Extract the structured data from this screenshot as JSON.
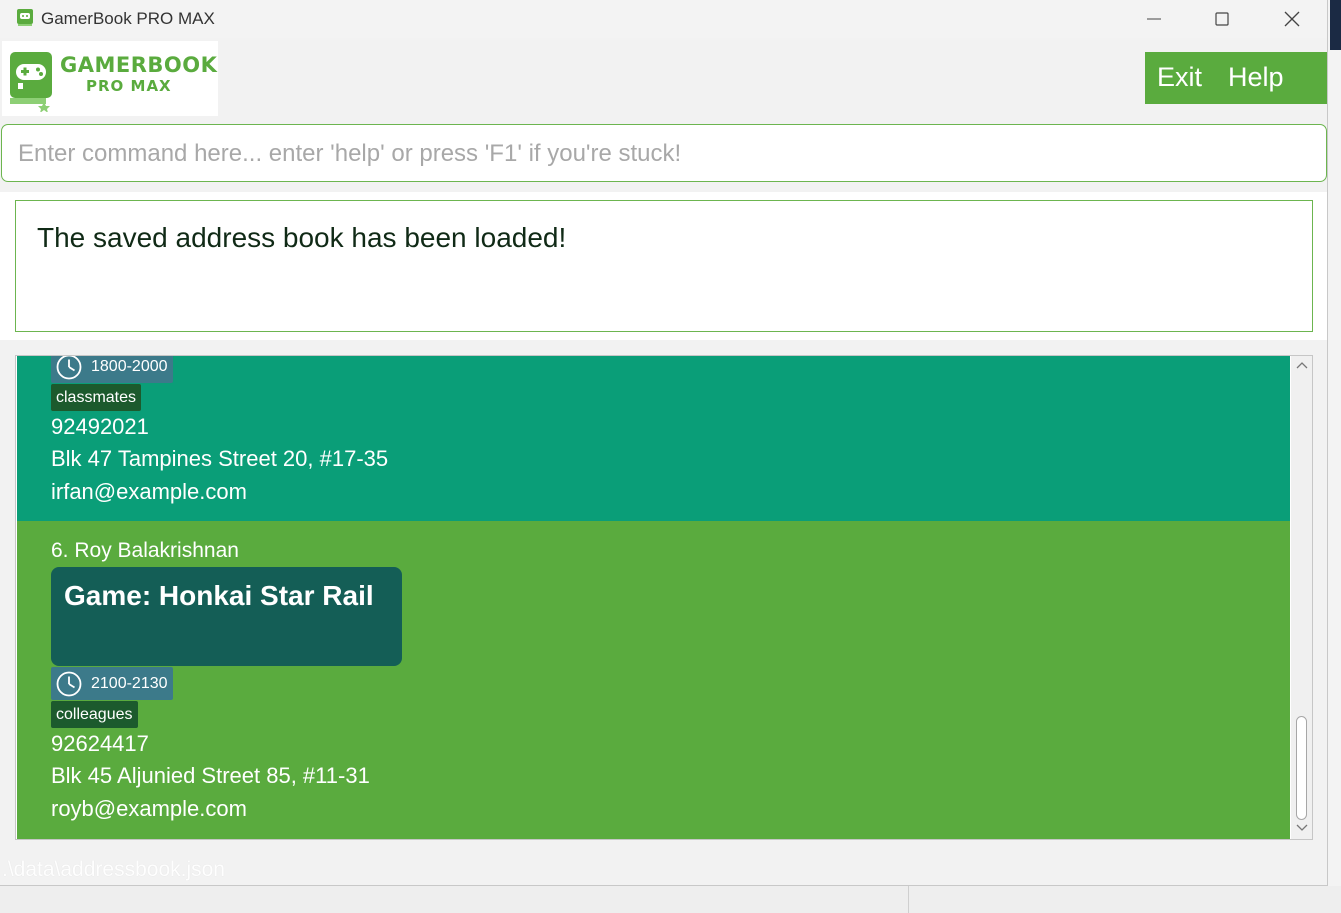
{
  "window": {
    "title": "GamerBook PRO MAX"
  },
  "logo": {
    "line1": "GAMERBOOK",
    "line2": "PRO MAX"
  },
  "menu": {
    "exit_label": "Exit",
    "help_label": "Help"
  },
  "command": {
    "placeholder": "Enter command here... enter 'help' or press 'F1' if you're stuck!",
    "value": ""
  },
  "result": {
    "message": "The saved address book has been loaded!"
  },
  "cards": [
    {
      "time": "1800-2000",
      "tag": "classmates",
      "phone": "92492021",
      "address": "Blk 47 Tampines Street 20, #17-35",
      "email": "irfan@example.com"
    },
    {
      "name": "6. Roy Balakrishnan",
      "game": "Game: Honkai Star Rail",
      "time": "2100-2130",
      "tag": "colleagues",
      "phone": "92624417",
      "address": "Blk 45 Aljunied Street 85, #11-31",
      "email": "royb@example.com"
    }
  ],
  "status": {
    "path": ".\\data\\addressbook.json"
  },
  "colors": {
    "brand_green": "#5aab3e",
    "card_teal": "#0a9e78",
    "game_box": "#145e56",
    "tag_bg": "#1c5a2d",
    "time_bg": "#3c7a8a"
  },
  "icons": {
    "app": "gamepad-book-icon",
    "time": "clock-icon",
    "minimize": "minimize-icon",
    "maximize": "maximize-icon",
    "close": "close-icon",
    "scroll_up": "chevron-up-icon",
    "scroll_down": "chevron-down-icon"
  }
}
